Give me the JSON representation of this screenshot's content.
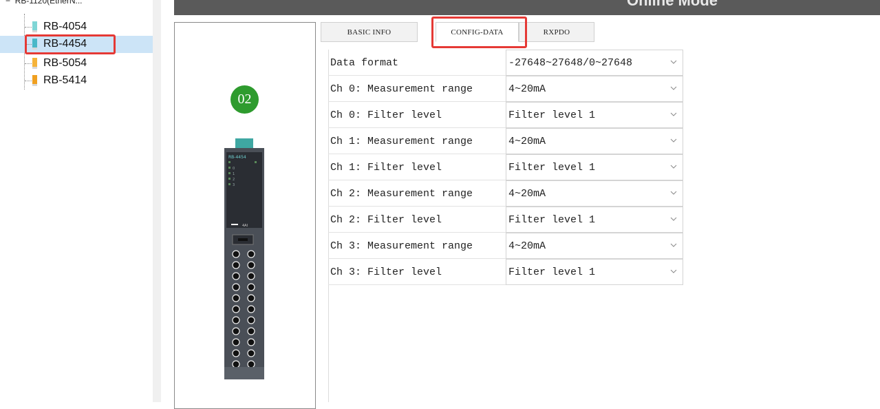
{
  "tree": {
    "root_label": "RB-1120(EtherN...",
    "items": [
      {
        "label": "RB-4054",
        "icon": "analog-module-icon",
        "color": "#7fd6d6",
        "selected": false
      },
      {
        "label": "RB-4454",
        "icon": "analog-module-icon",
        "color": "#4ab8c8",
        "selected": true
      },
      {
        "label": "RB-5054",
        "icon": "digital-module-icon",
        "color": "#f5b33a",
        "selected": false
      },
      {
        "label": "RB-5414",
        "icon": "digital-module-icon",
        "color": "#f0a020",
        "selected": false
      }
    ]
  },
  "header": {
    "title": "Online Mode"
  },
  "device": {
    "slot": "02",
    "module_label": "RB-4454",
    "channels": [
      "0",
      "1",
      "2",
      "3"
    ],
    "badge": "4AI"
  },
  "tabs": [
    {
      "label": "BASIC INFO",
      "active": false
    },
    {
      "label": "CONFIG-DATA",
      "active": true
    },
    {
      "label": "RXPDO",
      "active": false
    }
  ],
  "config": {
    "rows": [
      {
        "label": "Data format",
        "value": "-27648~27648/0~27648"
      },
      {
        "label": "Ch 0: Measurement range",
        "value": "4~20mA"
      },
      {
        "label": "Ch 0: Filter level",
        "value": "Filter level 1"
      },
      {
        "label": "Ch 1: Measurement range",
        "value": "4~20mA"
      },
      {
        "label": "Ch 1: Filter level",
        "value": "Filter level 1"
      },
      {
        "label": "Ch 2: Measurement range",
        "value": "4~20mA"
      },
      {
        "label": "Ch 2: Filter level",
        "value": "Filter level 1"
      },
      {
        "label": "Ch 3: Measurement range",
        "value": "4~20mA"
      },
      {
        "label": "Ch 3: Filter level",
        "value": "Filter level 1"
      }
    ]
  },
  "colors": {
    "highlight": "#e53935",
    "selection": "#cce4f7",
    "slot_badge": "#2e9b2e"
  }
}
